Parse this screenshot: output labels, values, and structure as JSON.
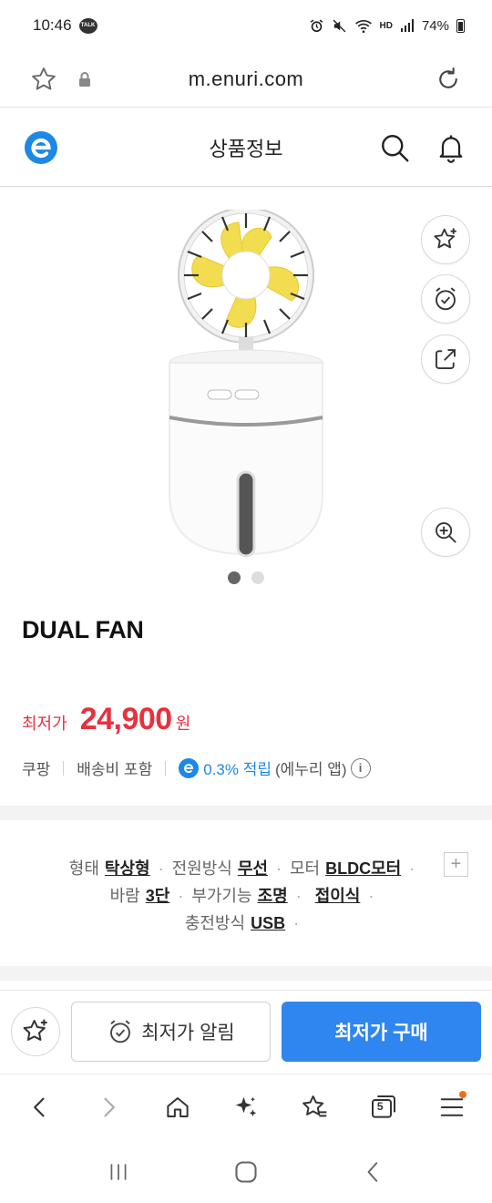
{
  "status_bar": {
    "time": "10:46",
    "talk_badge": "TALK",
    "signal_label": "HD",
    "battery": "74%"
  },
  "browser": {
    "url": "m.enuri.com"
  },
  "header": {
    "title": "상품정보"
  },
  "product": {
    "name": "DUAL FAN",
    "price_label": "최저가",
    "price": "24,900",
    "price_unit": "원",
    "seller": "쿠팡",
    "shipping": "배송비 포함",
    "reward": "0.3% 적립",
    "reward_note": "(에누리 앱)",
    "image_count": 2,
    "image_active_index": 0
  },
  "specs": {
    "line1": [
      {
        "key": "형태",
        "value": "탁상형"
      },
      {
        "key": "전원방식",
        "value": "무선"
      },
      {
        "key": "모터",
        "value": "BLDC모터"
      }
    ],
    "line2": [
      {
        "key": "바람",
        "value": "3단"
      },
      {
        "key": "부가기능",
        "value": "조명"
      },
      {
        "key": "",
        "value": "접이식"
      }
    ],
    "line3": [
      {
        "key": "충전방식",
        "value": "USB"
      }
    ],
    "expand_symbol": "+"
  },
  "actions": {
    "alert_label": "최저가 알림",
    "buy_label": "최저가 구매"
  },
  "browser_nav": {
    "tab_count": "5"
  },
  "colors": {
    "price_red": "#e8313f",
    "accent_blue": "#2f86f0",
    "brand_blue": "#1e88e5",
    "notification_orange": "#f26b1d"
  },
  "icons": {
    "url_bar": [
      "star-outline-icon",
      "lock-icon",
      "reload-icon"
    ],
    "header": [
      "enuri-logo-icon",
      "search-icon",
      "bell-icon"
    ],
    "image_side": [
      "star-add-icon",
      "alarm-clock-icon",
      "share-icon",
      "zoom-in-icon"
    ],
    "browser_nav": [
      "back-icon",
      "forward-icon",
      "home-icon",
      "sparkle-icon",
      "bookmark-star-icon",
      "tabs-icon",
      "menu-icon"
    ],
    "system_nav": [
      "recent-apps-icon",
      "home-circle-icon",
      "system-back-icon"
    ]
  }
}
